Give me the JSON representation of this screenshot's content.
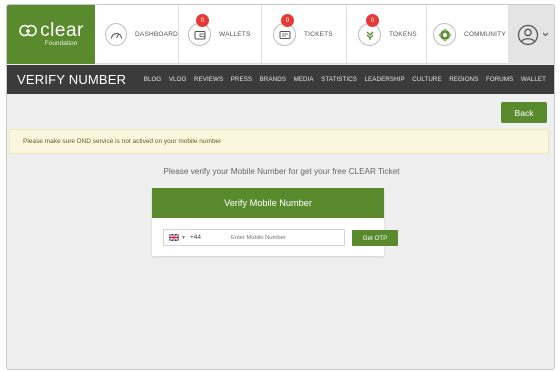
{
  "brand": {
    "name": "clear",
    "tagline": "Foundation",
    "color": "#5a8a2e"
  },
  "nav": [
    {
      "label": "DASHBOARD",
      "icon": "speedometer-icon"
    },
    {
      "label": "WALLETS",
      "icon": "wallet-icon",
      "badge": "0"
    },
    {
      "label": "TICKETS",
      "icon": "ticket-icon",
      "badge": "0"
    },
    {
      "label": "TOKENS",
      "icon": "tokens-icon",
      "badge": "0"
    },
    {
      "label": "COMMUNITY",
      "icon": "community-icon"
    }
  ],
  "profile": {
    "icon": "user-icon",
    "menu_icon": "chevron-down-icon"
  },
  "title_bar": {
    "title": "VERIFY NUMBER",
    "menu": [
      "BLOG",
      "VLOG",
      "REVIEWS",
      "PRESS",
      "BRANDS",
      "MEDIA",
      "STATISTICS",
      "LEADERSHIP",
      "CULTURE",
      "REGIONS",
      "FORUMS",
      "WALLET"
    ]
  },
  "back_label": "Back",
  "notice": "Please make sure DND service is not actived on your mobile number",
  "prompt": "Please verify your Mobile Number for get your free CLEAR Ticket",
  "verify_card": {
    "heading": "Verify Mobile Number",
    "country_code": "+44",
    "country_flag": "uk-flag-icon",
    "input_placeholder": "Enter Mobile Number",
    "input_value": "",
    "button_label": "Get OTP"
  }
}
